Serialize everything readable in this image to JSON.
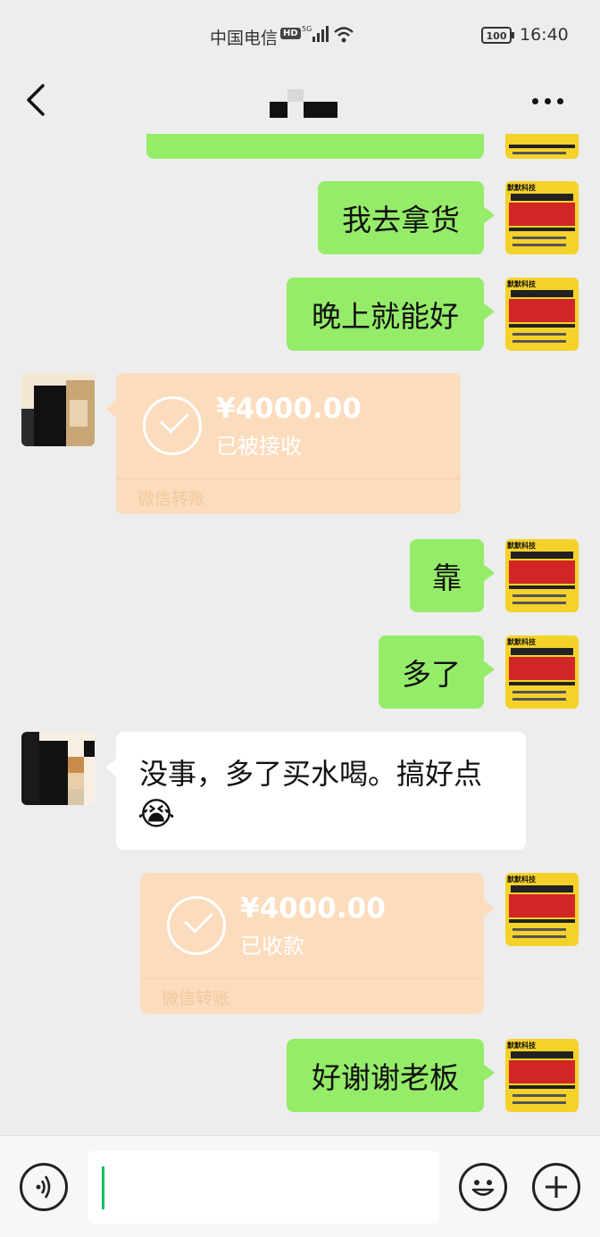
{
  "status_bar": {
    "carrier": "中国电信",
    "hd_badge": "HD",
    "network": "5G",
    "battery": "100",
    "time": "16:40"
  },
  "nav": {
    "back_icon": "chevron-left-icon",
    "more_icon": "more-dots-icon"
  },
  "my_avatar_text": "默默科技",
  "messages": [
    {
      "side": "right",
      "type": "text",
      "text": "我去拿货"
    },
    {
      "side": "right",
      "type": "text",
      "text": "晚上就能好"
    },
    {
      "side": "left",
      "type": "transfer",
      "amount": "¥4000.00",
      "status": "已被接收",
      "footer": "微信转账"
    },
    {
      "side": "right",
      "type": "text",
      "text": "靠"
    },
    {
      "side": "right",
      "type": "text",
      "text": "多了"
    },
    {
      "side": "left",
      "type": "text",
      "text": "没事，多了买水喝。搞好点",
      "emoji": "😭"
    },
    {
      "side": "right",
      "type": "transfer",
      "amount": "¥4000.00",
      "status": "已收款",
      "footer": "微信转账"
    },
    {
      "side": "right",
      "type": "text",
      "text": "好谢谢老板"
    }
  ],
  "input_bar": {
    "voice_icon": "voice-icon",
    "emoji_icon": "smiley-icon",
    "plus_icon": "plus-icon",
    "input_value": ""
  },
  "colors": {
    "background": "#ededed",
    "sent_bubble": "#95ec69",
    "received_bubble": "#ffffff",
    "transfer_card": "#fbdcbd",
    "avatar_yellow": "#f4d22a"
  }
}
